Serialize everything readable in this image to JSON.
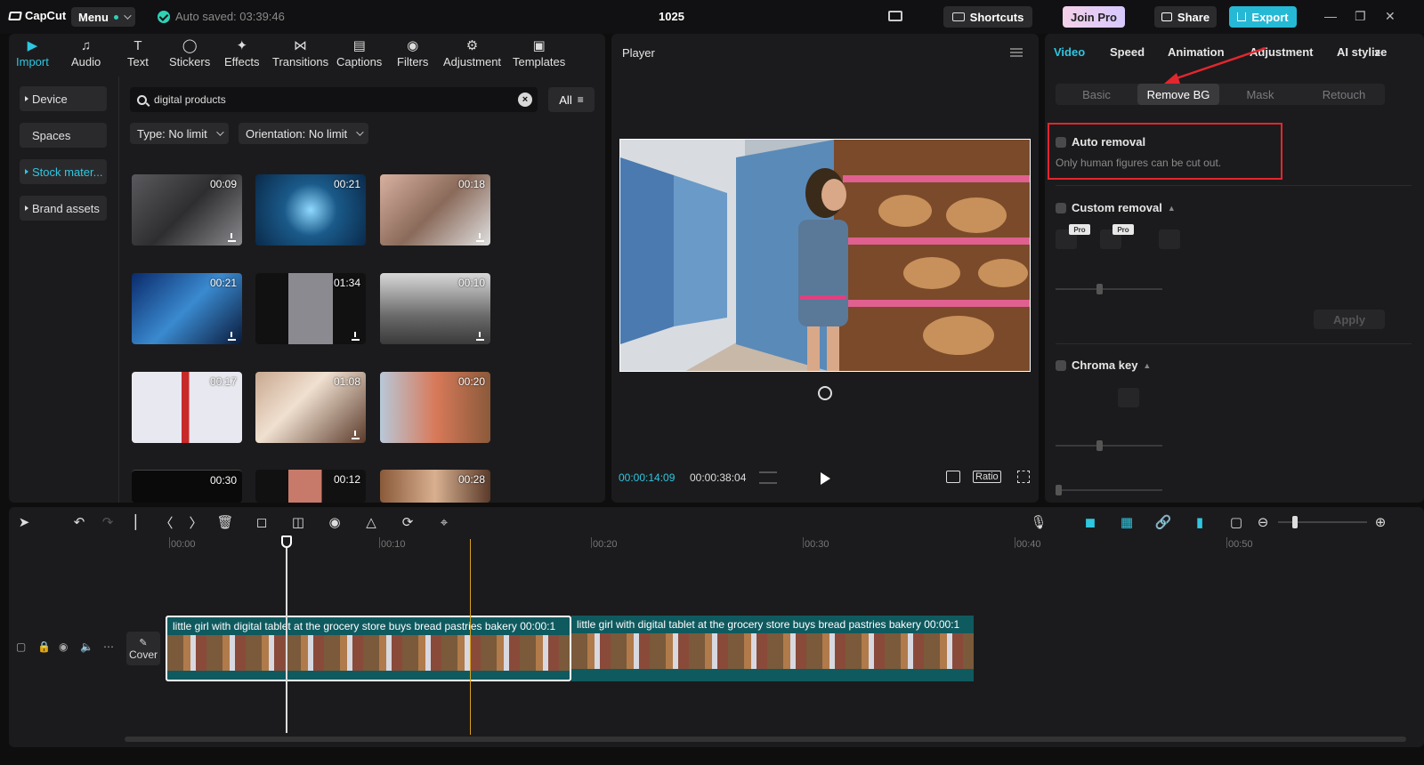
{
  "titlebar": {
    "app_name": "CapCut",
    "menu_label": "Menu",
    "autosave": "Auto saved: 03:39:46",
    "project_title": "1025",
    "shortcuts_label": "Shortcuts",
    "join_pro_label": "Join Pro",
    "share_label": "Share",
    "export_label": "Export"
  },
  "media": {
    "tools": [
      "Import",
      "Audio",
      "Text",
      "Stickers",
      "Effects",
      "Transitions",
      "Captions",
      "Filters",
      "Adjustment",
      "Templates"
    ],
    "sidebar": [
      "Device",
      "Spaces",
      "Stock mater...",
      "Brand assets"
    ],
    "search_value": "digital products",
    "all_label": "All",
    "type_filter": "Type: No limit",
    "orientation_filter": "Orientation: No limit",
    "thumbs": [
      {
        "dur": "00:09"
      },
      {
        "dur": "00:21"
      },
      {
        "dur": "00:18"
      },
      {
        "dur": "00:21"
      },
      {
        "dur": "01:34"
      },
      {
        "dur": "00:10"
      },
      {
        "dur": "00:17"
      },
      {
        "dur": "01:08"
      },
      {
        "dur": "00:20"
      },
      {
        "dur": "00:30"
      },
      {
        "dur": "00:12"
      },
      {
        "dur": "00:28"
      }
    ]
  },
  "player": {
    "title": "Player",
    "time_current": "00:00:14:09",
    "time_total": "00:00:38:04",
    "ratio_label": "Ratio"
  },
  "props": {
    "tabs": [
      "Video",
      "Speed",
      "Animation",
      "Adjustment",
      "AI stylize"
    ],
    "subtabs": [
      "Basic",
      "Remove BG",
      "Mask",
      "Retouch"
    ],
    "auto_removal": "Auto removal",
    "auto_hint": "Only human figures can be cut out.",
    "custom_removal": "Custom removal",
    "pro_badge": "Pro",
    "apply_label": "Apply",
    "chroma_key": "Chroma key"
  },
  "timeline": {
    "ruler": [
      "00:00",
      "00:10",
      "00:20",
      "00:30",
      "00:40",
      "00:50"
    ],
    "cover_label": "Cover",
    "clips": [
      {
        "label": "little girl with digital tablet at the grocery store buys bread pastries bakery  00:00:1"
      },
      {
        "label": "little girl with digital tablet at the grocery store buys bread pastries bakery  00:00:1"
      }
    ]
  },
  "colors": {
    "accent": "#2fc6e0",
    "highlight": "#e3262e"
  }
}
